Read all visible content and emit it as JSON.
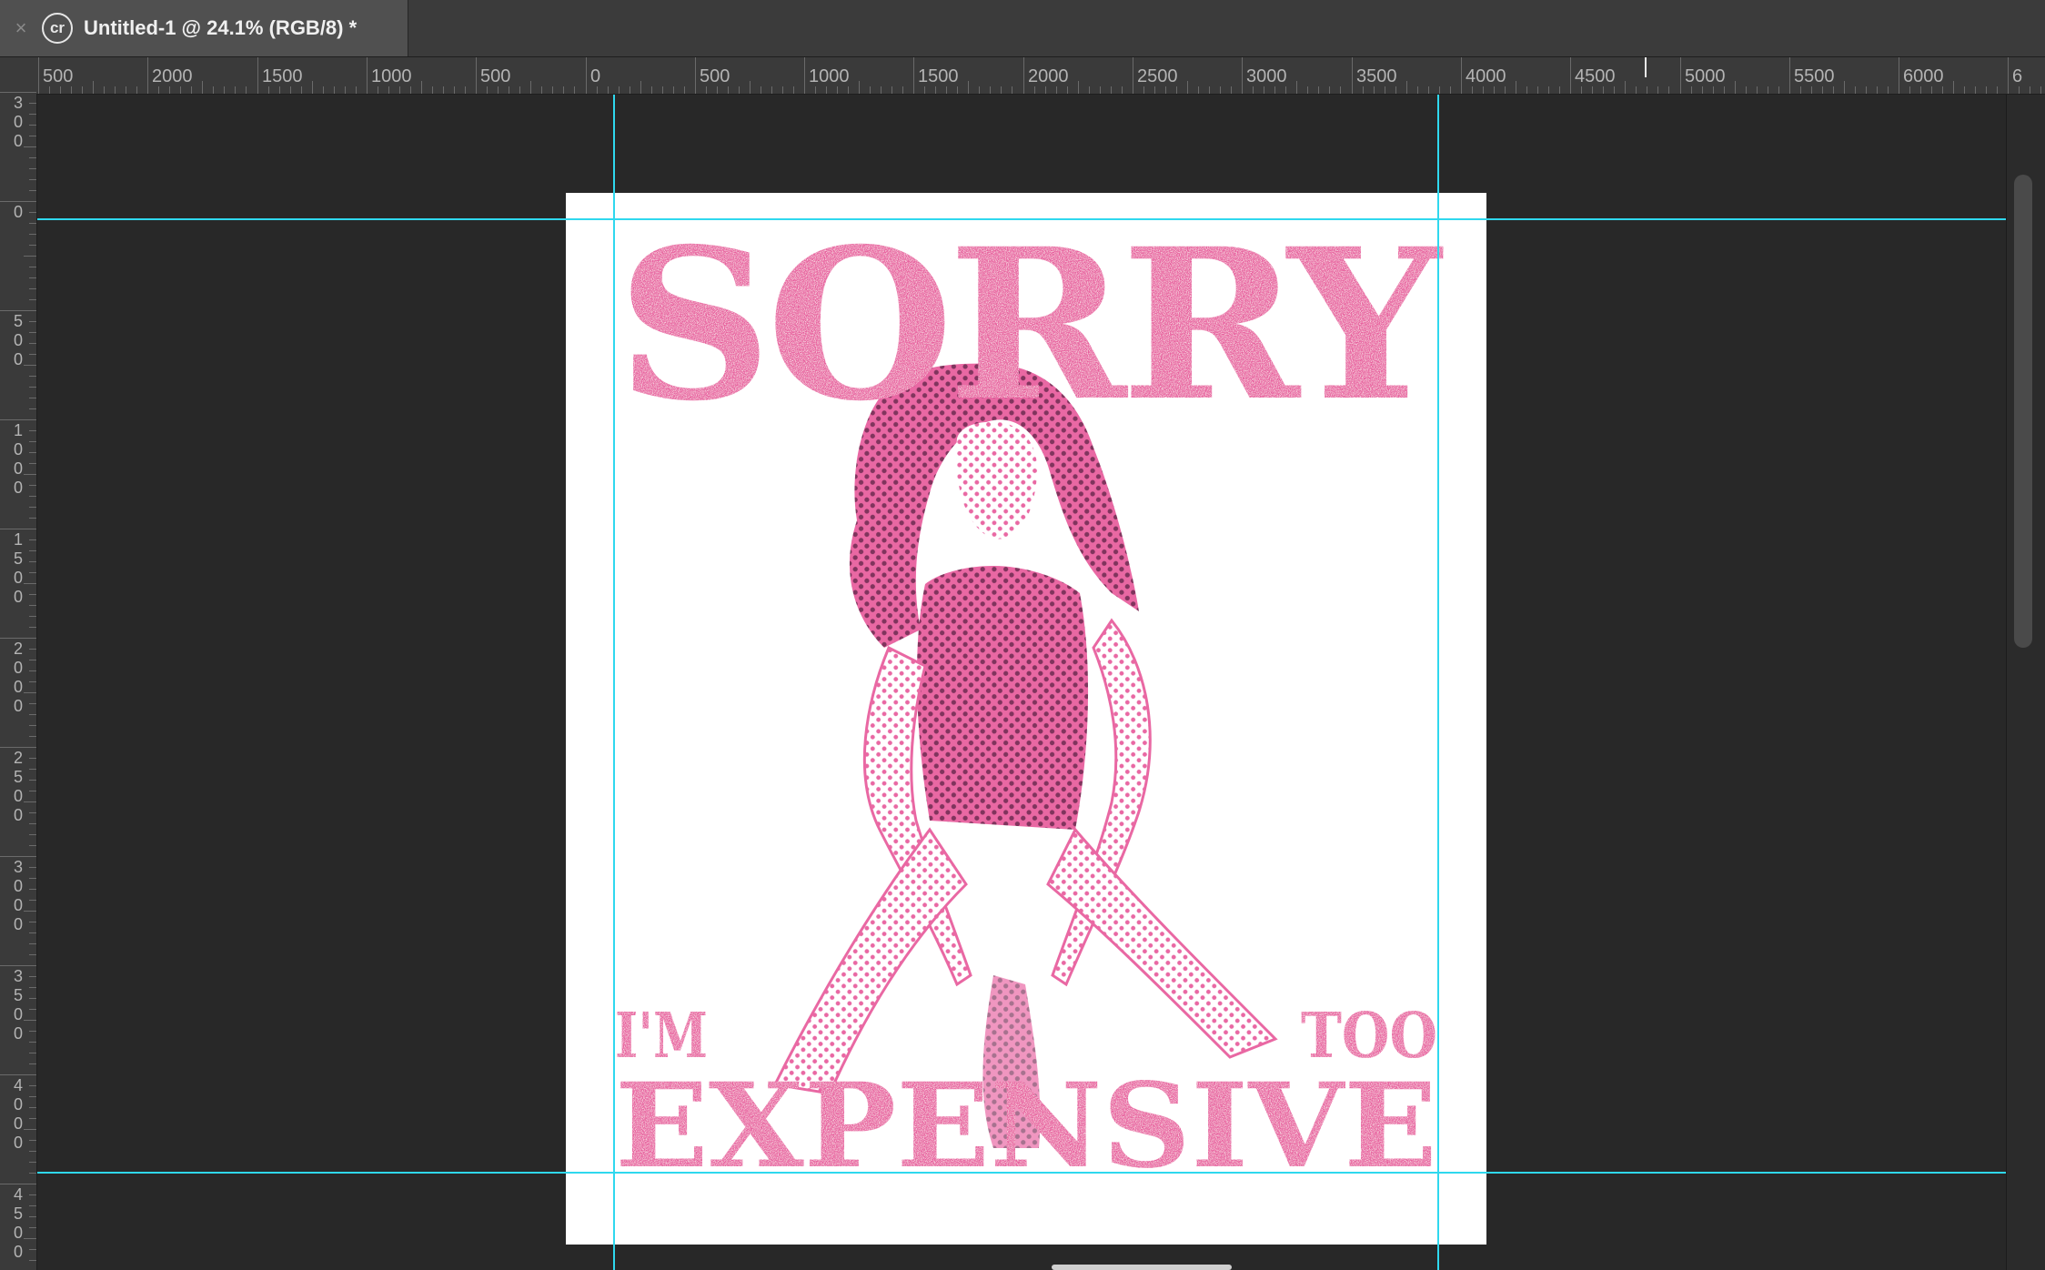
{
  "window": {
    "tab_title": "Untitled-1 @ 24.1% (RGB/8) *",
    "tab_badge": "cr",
    "close_glyph": "×"
  },
  "rulers": {
    "horizontal_labels": [
      "500",
      "2000",
      "1500",
      "1000",
      "500",
      "0",
      "500",
      "1000",
      "1500",
      "2000",
      "2500",
      "3000",
      "3500",
      "4000",
      "4500",
      "5000",
      "5500",
      "6000",
      "6"
    ],
    "vertical_labels": [
      "300",
      "0",
      "500",
      "1000",
      "1500",
      "2000",
      "2500",
      "3000",
      "3500",
      "4000",
      "4500"
    ]
  },
  "artwork": {
    "headline": "SORRY",
    "line_left": "I'M",
    "line_right": "TOO",
    "footer": "EXPENSIVE",
    "ink_color": "#e8609f",
    "dark_ink_color": "#7a2a55",
    "guide_color": "#2fd8ee"
  }
}
